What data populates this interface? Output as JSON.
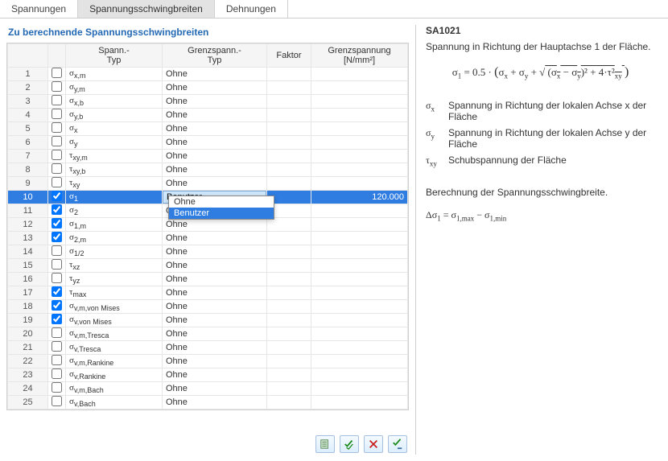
{
  "tabs": [
    "Spannungen",
    "Spannungsschwingbreiten",
    "Dehnungen"
  ],
  "activeTab": 1,
  "sectionTitle": "Zu berechnende Spannungsschwingbreiten",
  "headers": {
    "row": "",
    "chk": "",
    "spanType": "Spann.-\nTyp",
    "grenzType": "Grenzspann.-\nTyp",
    "faktor": "Faktor",
    "grenzSpan": "Grenzspannung\n[N/mm²]"
  },
  "rows": [
    {
      "n": 1,
      "chk": false,
      "spanType": "σx,m",
      "grenzType": "Ohne",
      "faktor": "",
      "gspan": ""
    },
    {
      "n": 2,
      "chk": false,
      "spanType": "σy,m",
      "grenzType": "Ohne",
      "faktor": "",
      "gspan": ""
    },
    {
      "n": 3,
      "chk": false,
      "spanType": "σx,b",
      "grenzType": "Ohne",
      "faktor": "",
      "gspan": ""
    },
    {
      "n": 4,
      "chk": false,
      "spanType": "σy,b",
      "grenzType": "Ohne",
      "faktor": "",
      "gspan": ""
    },
    {
      "n": 5,
      "chk": false,
      "spanType": "σx",
      "grenzType": "Ohne",
      "faktor": "",
      "gspan": ""
    },
    {
      "n": 6,
      "chk": false,
      "spanType": "σy",
      "grenzType": "Ohne",
      "faktor": "",
      "gspan": ""
    },
    {
      "n": 7,
      "chk": false,
      "spanType": "τxy,m",
      "grenzType": "Ohne",
      "faktor": "",
      "gspan": ""
    },
    {
      "n": 8,
      "chk": false,
      "spanType": "τxy,b",
      "grenzType": "Ohne",
      "faktor": "",
      "gspan": ""
    },
    {
      "n": 9,
      "chk": false,
      "spanType": "τxy",
      "grenzType": "Ohne",
      "faktor": "",
      "gspan": ""
    },
    {
      "n": 10,
      "chk": true,
      "spanType": "σ1",
      "grenzType": "Benutzer",
      "faktor": "",
      "gspan": "120.000",
      "selected": true
    },
    {
      "n": 11,
      "chk": true,
      "spanType": "σ2",
      "grenzType": "Ohne",
      "faktor": "",
      "gspan": ""
    },
    {
      "n": 12,
      "chk": true,
      "spanType": "σ1,m",
      "grenzType": "Ohne",
      "faktor": "",
      "gspan": ""
    },
    {
      "n": 13,
      "chk": true,
      "spanType": "σ2,m",
      "grenzType": "Ohne",
      "faktor": "",
      "gspan": ""
    },
    {
      "n": 14,
      "chk": false,
      "spanType": "σ1/2",
      "grenzType": "Ohne",
      "faktor": "",
      "gspan": ""
    },
    {
      "n": 15,
      "chk": false,
      "spanType": "τxz",
      "grenzType": "Ohne",
      "faktor": "",
      "gspan": ""
    },
    {
      "n": 16,
      "chk": false,
      "spanType": "τyz",
      "grenzType": "Ohne",
      "faktor": "",
      "gspan": ""
    },
    {
      "n": 17,
      "chk": true,
      "spanType": "τmax",
      "grenzType": "Ohne",
      "faktor": "",
      "gspan": ""
    },
    {
      "n": 18,
      "chk": true,
      "spanType": "σv,m,von Mises",
      "grenzType": "Ohne",
      "faktor": "",
      "gspan": ""
    },
    {
      "n": 19,
      "chk": true,
      "spanType": "σv,von Mises",
      "grenzType": "Ohne",
      "faktor": "",
      "gspan": ""
    },
    {
      "n": 20,
      "chk": false,
      "spanType": "σv,m,Tresca",
      "grenzType": "Ohne",
      "faktor": "",
      "gspan": ""
    },
    {
      "n": 21,
      "chk": false,
      "spanType": "σv,Tresca",
      "grenzType": "Ohne",
      "faktor": "",
      "gspan": ""
    },
    {
      "n": 22,
      "chk": false,
      "spanType": "σv,m,Rankine",
      "grenzType": "Ohne",
      "faktor": "",
      "gspan": ""
    },
    {
      "n": 23,
      "chk": false,
      "spanType": "σv,Rankine",
      "grenzType": "Ohne",
      "faktor": "",
      "gspan": ""
    },
    {
      "n": 24,
      "chk": false,
      "spanType": "σv,m,Bach",
      "grenzType": "Ohne",
      "faktor": "",
      "gspan": ""
    },
    {
      "n": 25,
      "chk": false,
      "spanType": "σv,Bach",
      "grenzType": "Ohne",
      "faktor": "",
      "gspan": ""
    }
  ],
  "dropdown": {
    "options": [
      "Ohne",
      "Benutzer"
    ],
    "selected": "Benutzer"
  },
  "info": {
    "code": "SA1021",
    "headline": "Spannung in Richtung der Hauptachse 1 der Fläche.",
    "defs": [
      {
        "sym": "σx",
        "txt": "Spannung in Richtung der lokalen Achse x der Fläche"
      },
      {
        "sym": "σy",
        "txt": "Spannung in Richtung der lokalen Achse y der Fläche"
      },
      {
        "sym": "τxy",
        "txt": "Schubspannung der Fläche"
      }
    ],
    "calcTitle": "Berechnung der Spannungsschwingbreite.",
    "calcEq": "Δσ1 = σ1,max − σ1,min"
  }
}
